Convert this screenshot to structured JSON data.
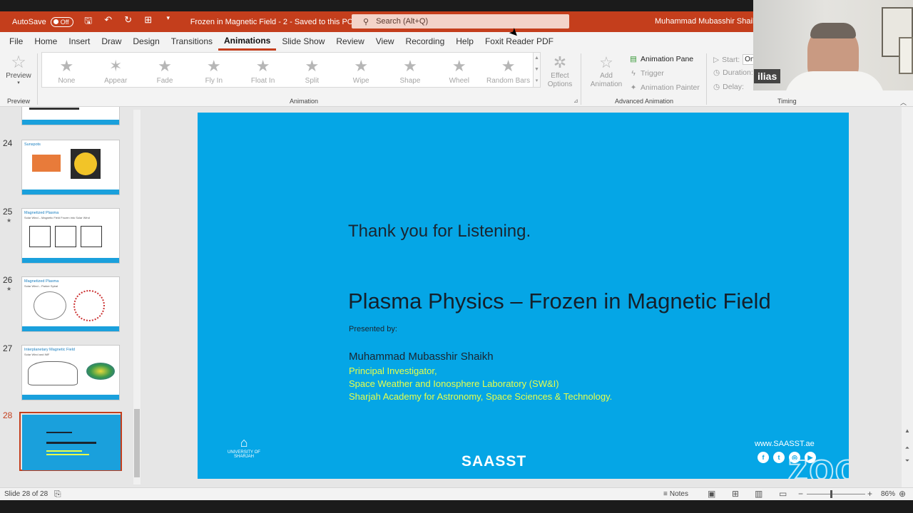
{
  "titlebar": {
    "autosave_label": "AutoSave",
    "autosave_state": "Off",
    "document_title": "Frozen in Magnetic Field - 2  -  Saved to this PC",
    "search_placeholder": "Search (Alt+Q)",
    "user_name": "Muhammad Mubasshir Shaikh",
    "accent_color": "#c43e1c"
  },
  "menu": {
    "tabs": [
      "File",
      "Home",
      "Insert",
      "Draw",
      "Design",
      "Transitions",
      "Animations",
      "Slide Show",
      "Review",
      "View",
      "Recording",
      "Help",
      "Foxit Reader PDF"
    ],
    "active_tab": "Animations"
  },
  "ribbon": {
    "preview": {
      "label": "Preview",
      "group": "Preview"
    },
    "animation_gallery": {
      "group": "Animation",
      "items": [
        "None",
        "Appear",
        "Fade",
        "Fly In",
        "Float In",
        "Split",
        "Wipe",
        "Shape",
        "Wheel",
        "Random Bars"
      ]
    },
    "effect_options": {
      "label": "Effect Options"
    },
    "advanced": {
      "group": "Advanced Animation",
      "add_animation": "Add Animation",
      "animation_pane": "Animation Pane",
      "trigger": "Trigger",
      "animation_painter": "Animation Painter"
    },
    "timing": {
      "group": "Timing",
      "start_label": "Start:",
      "start_value": "On",
      "duration_label": "Duration:",
      "delay_label": "Delay:"
    }
  },
  "webcam": {
    "participant_name": "ilias"
  },
  "thumbnails": [
    {
      "number": "24",
      "title": "Sunspots",
      "subtitle": "",
      "starred": false,
      "active": false
    },
    {
      "number": "25",
      "title": "Magnetized Plasma",
      "subtitle": "Solar Wind – Magnetic Field Frozen into Solar Wind",
      "starred": true,
      "active": false
    },
    {
      "number": "26",
      "title": "Magnetized Plasma",
      "subtitle": "Solar Wind – Parker Spiral",
      "starred": true,
      "active": false
    },
    {
      "number": "27",
      "title": "Interplanetary Magnetic Field",
      "subtitle": "Solar Wind and IMF",
      "starred": false,
      "active": false
    },
    {
      "number": "28",
      "title": "",
      "subtitle": "",
      "starred": false,
      "active": true
    }
  ],
  "slide": {
    "thanks": "Thank you for Listening.",
    "headline": "Plasma Physics – Frozen in Magnetic Field",
    "presented_by": "Presented by:",
    "author": "Muhammad Mubasshir Shaikh",
    "affiliations": [
      "Principal Investigator,",
      "Space Weather and Ionosphere Laboratory (SW&I)",
      "Sharjah Academy for Astronomy, Space Sciences & Technology."
    ],
    "uni_logo_text": "UNIVERSITY OF SHARJAH",
    "brand_logo": "SAASST",
    "website": "www.SAASST.ae",
    "background_color": "#05a6e6"
  },
  "watermark": "zoom",
  "statusbar": {
    "slide_count": "Slide 28 of 28",
    "notes_label": "Notes",
    "zoom_percent": "86%"
  }
}
